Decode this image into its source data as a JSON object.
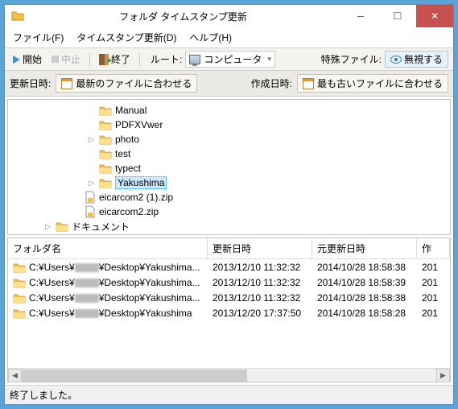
{
  "title": "フォルダ タイムスタンプ更新",
  "menu": {
    "file": "ファイル(F)",
    "update": "タイムスタンプ更新(D)",
    "help": "ヘルプ(H)"
  },
  "toolbar": {
    "start": "開始",
    "stop": "中止",
    "exit": "終了",
    "root_label": "ルート:",
    "root_value": "コンピュータ",
    "special_label": "特殊ファイル:",
    "ignore": "無視する"
  },
  "options": {
    "update_label": "更新日時:",
    "update_btn": "最新のファイルに合わせる",
    "create_label": "作成日時:",
    "create_btn": "最も古いファイルに合わせる"
  },
  "tree": [
    {
      "name": "Manual",
      "type": "folder",
      "level": 1,
      "exp": ""
    },
    {
      "name": "PDFXVwer",
      "type": "folder",
      "level": 1,
      "exp": ""
    },
    {
      "name": "photo",
      "type": "folder",
      "level": 1,
      "exp": "▷"
    },
    {
      "name": "test",
      "type": "folder",
      "level": 1,
      "exp": ""
    },
    {
      "name": "typect",
      "type": "folder",
      "level": 1,
      "exp": ""
    },
    {
      "name": "Yakushima",
      "type": "folder",
      "level": 1,
      "exp": "▷",
      "sel": true
    },
    {
      "name": "eicarcom2 (1).zip",
      "type": "file",
      "level": 2,
      "exp": ""
    },
    {
      "name": "eicarcom2.zip",
      "type": "file",
      "level": 2,
      "exp": ""
    },
    {
      "name": "ドキュメント",
      "type": "folder",
      "level": 0,
      "exp": "▷",
      "doc": true
    }
  ],
  "table": {
    "headers": {
      "folder": "フォルダ名",
      "update": "更新日時",
      "orig": "元更新日時",
      "create": "作"
    },
    "rows": [
      {
        "path_pre": "C:¥Users¥",
        "path_post": "¥Desktop¥Yakushima...",
        "update": "2013/12/10 11:32:32",
        "orig": "2014/10/28 18:58:38",
        "create": "201"
      },
      {
        "path_pre": "C:¥Users¥",
        "path_post": "¥Desktop¥Yakushima...",
        "update": "2013/12/10 11:32:32",
        "orig": "2014/10/28 18:58:39",
        "create": "201"
      },
      {
        "path_pre": "C:¥Users¥",
        "path_post": "¥Desktop¥Yakushima...",
        "update": "2013/12/10 11:32:32",
        "orig": "2014/10/28 18:58:38",
        "create": "201"
      },
      {
        "path_pre": "C:¥Users¥",
        "path_post": "¥Desktop¥Yakushima",
        "update": "2013/12/20 17:37:50",
        "orig": "2014/10/28 18:58:28",
        "create": "201"
      }
    ]
  },
  "status": "終了しました。"
}
